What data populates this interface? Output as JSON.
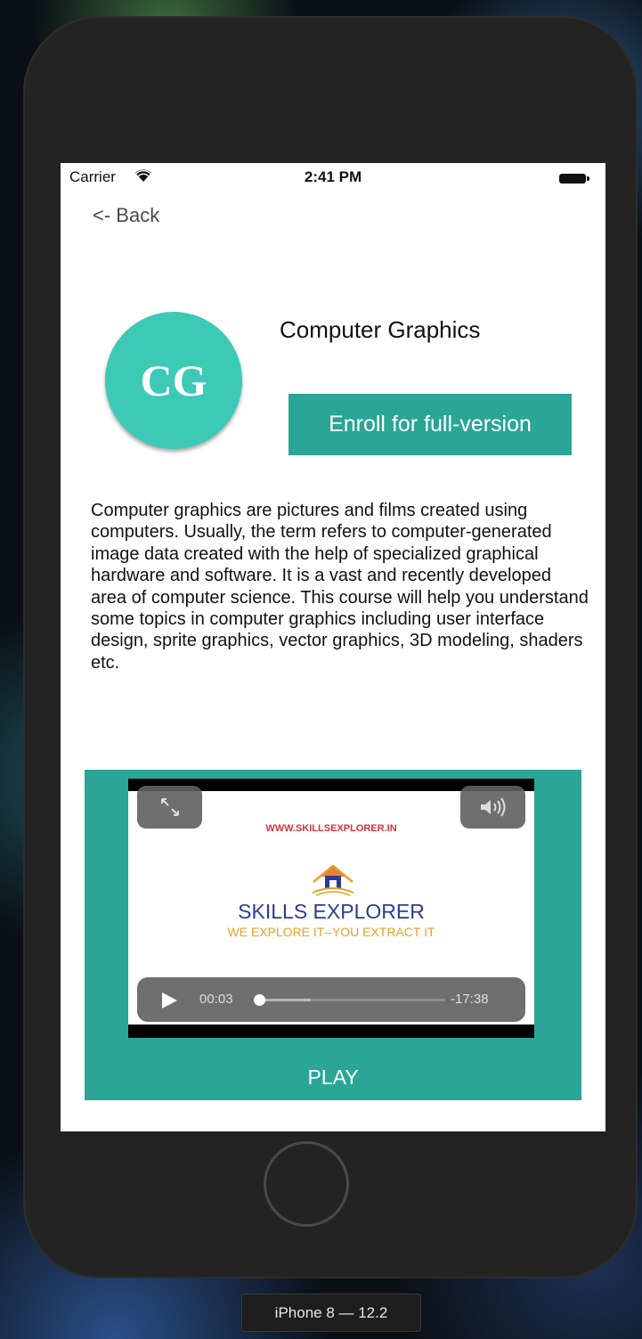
{
  "status_bar": {
    "carrier": "Carrier",
    "time": "2:41 PM"
  },
  "nav": {
    "back_label": "<- Back"
  },
  "course": {
    "avatar_initials": "CG",
    "title": "Computer Graphics",
    "enroll_label": "Enroll for full-version",
    "description": "Computer graphics are pictures and films created using computers. Usually, the term refers to computer-generated image data created with the help of specialized graphical hardware and software. It is a vast and recently developed area of computer science. This course will help you understand some topics in computer graphics including user interface design, sprite graphics, vector graphics, 3D modeling, shaders etc."
  },
  "video": {
    "url_text": "WWW.SKILLSEXPLORER.IN",
    "brand_name": "SKILLS EXPLORER",
    "brand_tagline": "WE EXPLORE IT--YOU EXTRACT IT",
    "elapsed": "00:03",
    "remaining": "-17:38",
    "progress_fraction": 0.003,
    "buffered_fraction": 0.28,
    "play_label": "PLAY"
  },
  "device": {
    "label": "iPhone 8 — 12.2"
  },
  "colors": {
    "accent": "#2aa596",
    "avatar": "#3cc9b6",
    "url_red": "#d5333b",
    "brand_blue": "#2c3d8f",
    "tagline_orange": "#e3a128"
  },
  "icons": {
    "wifi": "wifi-icon",
    "battery": "battery-icon",
    "fullscreen": "expand-icon",
    "volume": "speaker-icon",
    "play": "play-icon",
    "logo": "house-icon"
  }
}
